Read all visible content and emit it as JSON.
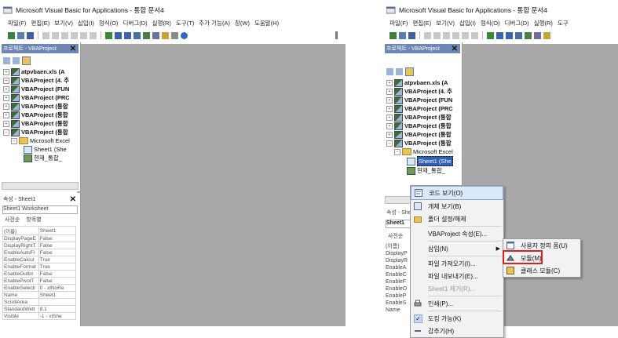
{
  "left": {
    "title": "Microsoft Visual Basic for Applications - 통합 문서4",
    "menu": [
      "파일(F)",
      "편집(E)",
      "보기(V)",
      "삽입(I)",
      "형식(O)",
      "디버그(D)",
      "실행(R)",
      "도구(T)",
      "추가 기능(A)",
      "창(W)",
      "도움말(H)"
    ],
    "project_title": "프로젝트 - VBAProject",
    "tree": [
      "atpvbaen.xls (A",
      "VBAProject (4. 추",
      "VBAProject (FUN",
      "VBAProject (PRC",
      "VBAProject (통합",
      "VBAProject (통합",
      "VBAProject (통합",
      "VBAProject (통합"
    ],
    "folder": "Microsoft Excel",
    "sheet1": "Sheet1 (She",
    "thisbook": "현재_통합_",
    "props_title": "속성 - Sheet1",
    "props_combo": "Sheet1 Worksheet",
    "props_tabs": [
      "사전순",
      "항목별"
    ],
    "props_rows": [
      [
        "(이름)",
        "Sheet1"
      ],
      [
        "DisplayPageE",
        "False"
      ],
      [
        "DisplayRightT",
        "False"
      ],
      [
        "EnableAutoFi",
        "False"
      ],
      [
        "EnableCalcul",
        "True"
      ],
      [
        "EnableFormat",
        "True"
      ],
      [
        "EnableOutlin",
        "False"
      ],
      [
        "EnablePivotT",
        "False"
      ],
      [
        "EnableSelecti",
        "0 - xlNoRe"
      ],
      [
        "Name",
        "Sheet1"
      ],
      [
        "ScrollArea",
        ""
      ],
      [
        "StandardWidt",
        "8.1"
      ],
      [
        "Visible",
        "-1 - xlShe"
      ]
    ]
  },
  "right": {
    "title": "Microsoft Visual Basic for Applications - 통합 문서4",
    "menu": [
      "파일(F)",
      "편집(E)",
      "보기(V)",
      "삽입(I)",
      "형식(O)",
      "디버그(D)",
      "실행(R)",
      "도구"
    ],
    "project_title": "프로젝트 - VBAProject",
    "tree": [
      "atpvbaen.xls (A",
      "VBAProject (4. 추",
      "VBAProject (FUN",
      "VBAProject (PRC",
      "VBAProject (통합",
      "VBAProject (통합",
      "VBAProject (통합",
      "VBAProject (통합"
    ],
    "folder": "Microsoft Excel",
    "sheet1": "Sheet1 (She",
    "thisbook": "현재_통합_",
    "props_title": "속성 - She",
    "props_combo": "Sheet1",
    "props_tab": "사전순",
    "props_names": [
      "(이름)",
      "DisplayP",
      "DisplayR",
      "EnableA",
      "EnableC",
      "EnableF",
      "EnableO",
      "EnableP",
      "EnableS",
      "Name"
    ]
  },
  "context_menu": {
    "items": [
      {
        "label": "코드 보기(O)",
        "type": "normal",
        "icon": "code-icon"
      },
      {
        "label": "개체 보기(B)",
        "type": "normal",
        "icon": "object-icon"
      },
      {
        "label": "폴더 설정/해제",
        "type": "normal",
        "icon": "folder-icon"
      },
      {
        "label": "VBAProject 속성(E)...",
        "type": "normal",
        "icon": ""
      },
      {
        "label": "삽입(N)",
        "type": "submenu",
        "icon": ""
      },
      {
        "label": "파일 가져오기(I)...",
        "type": "normal",
        "icon": ""
      },
      {
        "label": "파일 내보내기(E)...",
        "type": "normal",
        "icon": ""
      },
      {
        "label": "Sheet1 제거(R)...",
        "type": "disabled",
        "icon": ""
      },
      {
        "label": "인쇄(P)...",
        "type": "normal",
        "icon": "print-icon"
      },
      {
        "label": "도킹 가능(K)",
        "type": "check",
        "icon": "check-icon"
      },
      {
        "label": "감추기(H)",
        "type": "normal",
        "icon": "hide-icon"
      }
    ]
  },
  "submenu": {
    "items": [
      "사용자 정의 폼(U)",
      "모듈(M)",
      "클래스 모듈(C)"
    ],
    "highlighted": "모듈(M)"
  },
  "colors": {
    "workspace": "#a9a9a9",
    "titlebar_pane": "#6d86b3",
    "highlight": "#e02020",
    "selection": "#2f5fb7"
  }
}
